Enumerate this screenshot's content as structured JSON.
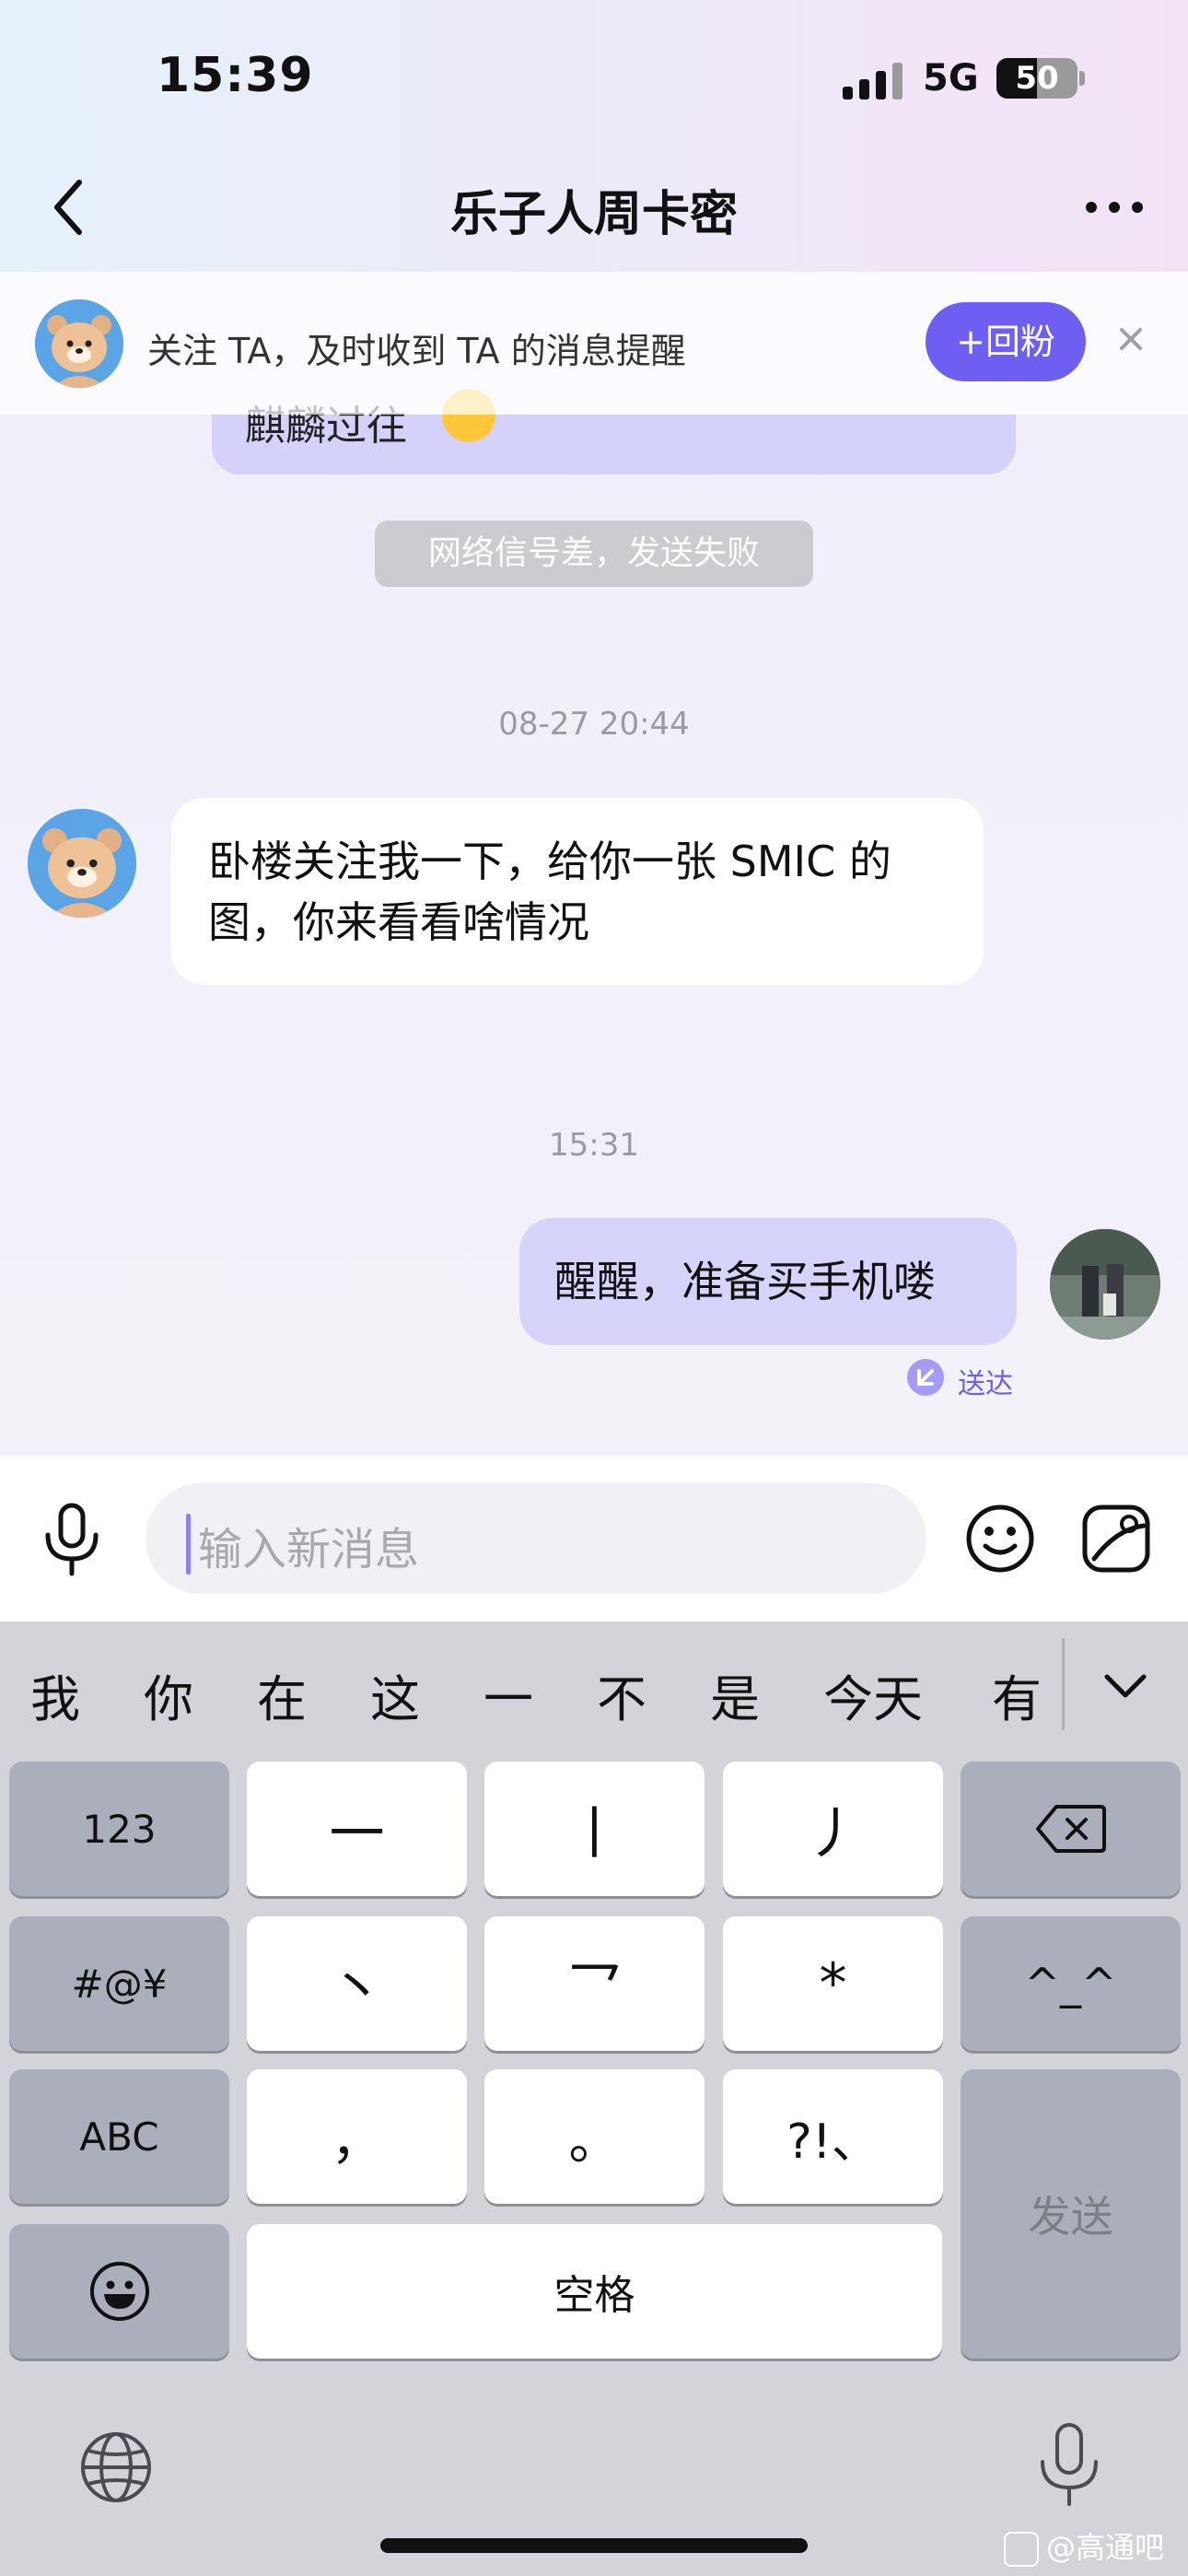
{
  "status_bar": {
    "time": "15:39",
    "network": "5G",
    "battery": "50",
    "battery_level": 0.5
  },
  "header": {
    "title": "乐子人周卡密"
  },
  "follow_banner": {
    "text": "关注 TA，及时收到 TA 的消息提醒",
    "button": "+回粉"
  },
  "messages": {
    "partial_text": "麒麟过往",
    "system_notice": "网络信号差，发送失败",
    "timestamp_1": "08-27  20:44",
    "incoming_line1": "卧楼关注我一下，给你一张 SMIC 的",
    "incoming_line2": "图，你来看看啥情况",
    "timestamp_2": "15:31",
    "outgoing": "醒醒，准备买手机喽",
    "delivered": "送达"
  },
  "input": {
    "placeholder": "输入新消息"
  },
  "keyboard": {
    "candidates": [
      "我",
      "你",
      "在",
      "这",
      "一",
      "不",
      "是",
      "今天",
      "有"
    ],
    "keys": {
      "num": "123",
      "sym": "#@¥",
      "abc": "ABC",
      "stroke1": "一",
      "stroke2": "丨",
      "stroke3": "丿",
      "stroke4": "丶",
      "stroke5": "乛",
      "wildcard": "*",
      "comma": "，",
      "period": "。",
      "punct": "?!、",
      "kaomoji": "^_^",
      "send": "发送",
      "space": "空格"
    }
  },
  "watermark": "@高通吧"
}
